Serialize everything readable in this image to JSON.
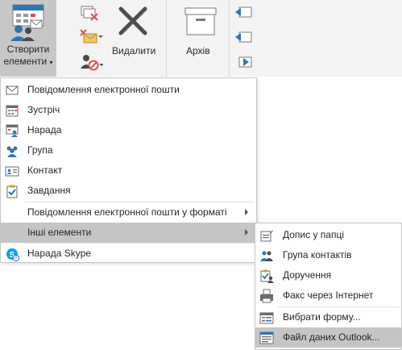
{
  "ribbon": {
    "new_items": {
      "line1": "Створити",
      "line2": "елементи"
    },
    "delete_label": "Видалити",
    "archive_label": "Архів"
  },
  "menu": {
    "items": [
      {
        "label": "Повідомлення електронної пошти",
        "icon": "email-icon"
      },
      {
        "label": "Зустріч",
        "icon": "calendar-icon"
      },
      {
        "label": "Нарада",
        "icon": "meeting-icon"
      },
      {
        "label": "Група",
        "icon": "group-icon"
      },
      {
        "label": "Контакт",
        "icon": "contact-card-icon"
      },
      {
        "label": "Завдання",
        "icon": "task-icon"
      },
      {
        "label": "Повідомлення електронної пошти у форматі",
        "icon": ""
      },
      {
        "label": "Інші елементи",
        "icon": ""
      },
      {
        "label": "Нарада Skype",
        "icon": "skype-icon"
      }
    ]
  },
  "submenu": {
    "items": [
      {
        "label": "Допис у папці",
        "icon": "folder-post-icon"
      },
      {
        "label": "Група контактів",
        "icon": "contact-group-icon"
      },
      {
        "label": "Доручення",
        "icon": "task-request-icon"
      },
      {
        "label": "Факс через Інтернет",
        "icon": "fax-icon"
      },
      {
        "label": "Вибрати форму...",
        "icon": "form-icon"
      },
      {
        "label": "Файл даних Outlook...",
        "icon": "data-file-icon"
      }
    ]
  },
  "colors": {
    "accent": "#2e75b6",
    "active_bg": "#c5c5c5",
    "delete_x": "#505050"
  }
}
